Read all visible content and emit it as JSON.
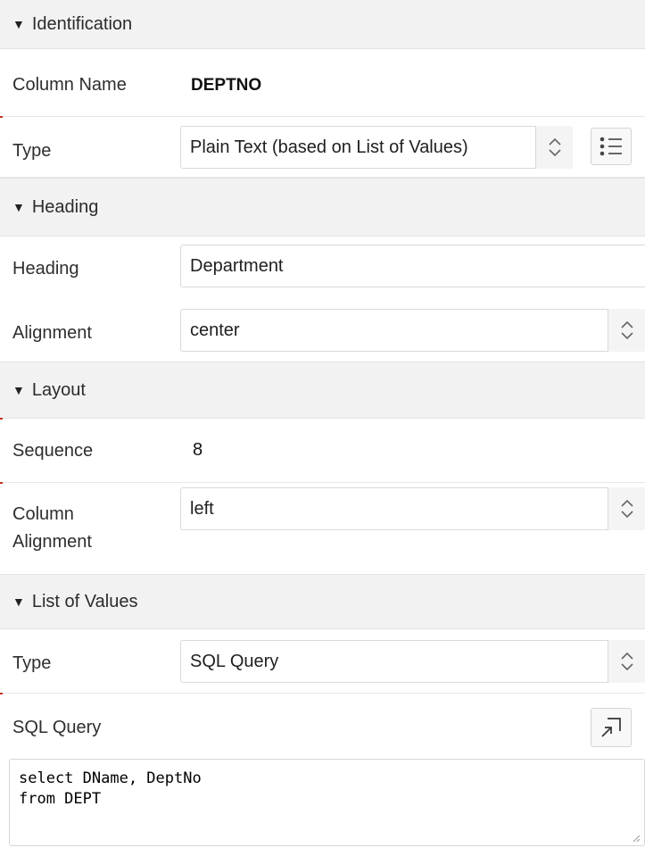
{
  "sections": {
    "identification": "Identification",
    "heading": "Heading",
    "layout": "Layout",
    "lov": "List of Values"
  },
  "identification": {
    "column_name_label": "Column Name",
    "column_name_value": "DEPTNO",
    "type_label": "Type",
    "type_value": "Plain Text (based on List of Values)"
  },
  "heading": {
    "heading_label": "Heading",
    "heading_value": "Department",
    "alignment_label": "Alignment",
    "alignment_value": "center"
  },
  "layout": {
    "sequence_label": "Sequence",
    "sequence_value": "8",
    "column_alignment_label_line1": "Column",
    "column_alignment_label_line2": "Alignment",
    "column_alignment_value": "left"
  },
  "lov": {
    "type_label": "Type",
    "type_value": "SQL Query",
    "sql_query_label": "SQL Query",
    "sql_query_value": "select DName, DeptNo\nfrom DEPT"
  },
  "icons": {
    "collapse": "triangle-down-icon",
    "select": "up-down-chevron-icon",
    "list": "list-icon",
    "expand": "expand-editor-icon",
    "resize": "resize-grip-icon"
  },
  "colors": {
    "section_bg": "#f2f2f2",
    "accent_mark": "#c8302a"
  }
}
